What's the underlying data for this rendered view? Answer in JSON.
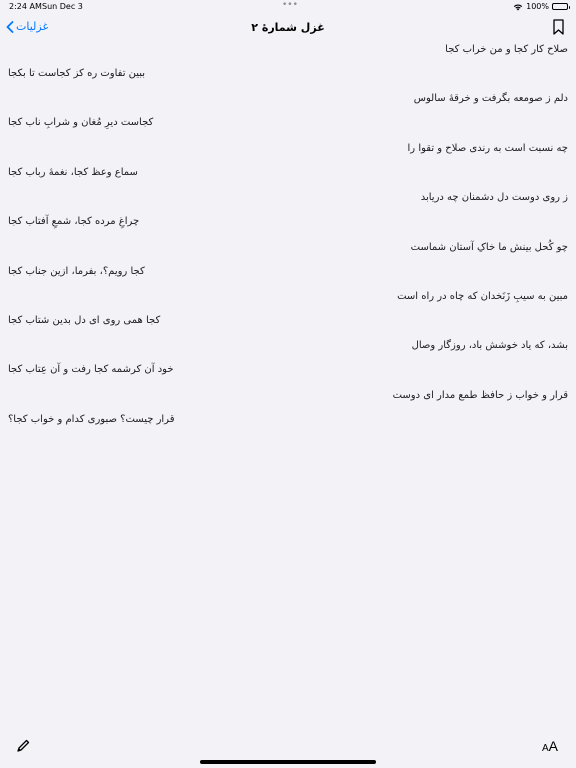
{
  "status_bar": {
    "time": "2:24 AM",
    "date": "Sun Dec 3",
    "battery": "100%",
    "multitask_dots": "•••"
  },
  "nav": {
    "back_label": "غزلیات",
    "title": "غزل شمارهٔ ۲",
    "back_icon": "chevron-left-icon",
    "bookmark_icon": "bookmark-icon",
    "accent_color": "#007aff"
  },
  "poem": {
    "verses": [
      {
        "h1": "صلاح کار کجا و من خراب کجا",
        "h2": "ببین تفاوت ره کز کجاست تا بکجا"
      },
      {
        "h1": "دلم ز صومعه بگرفت و خرقهٔ سالوس",
        "h2": "کجاست دیرِ مُغان و شرابِ ناب کجا"
      },
      {
        "h1": "چه نسبت است به رندی صلاح و تقوا را",
        "h2": "سماع وعظ کجا، نغمهٔ رباب کجا"
      },
      {
        "h1": "ز روی دوست دل دشمنان چه دریابد",
        "h2": "چراغِ مرده کجا، شمعِ آفتاب کجا"
      },
      {
        "h1": "چو کُحل بینش ما خاکِ آستان شماست",
        "h2": "کجا رویم؟، بفرما، ازین جناب کجا"
      },
      {
        "h1": "مبین به سیبِ زَنَخدان که چاه در راه است",
        "h2": "کجا همی روی ای دل بدین شتاب کجا"
      },
      {
        "h1": "بشد، که یاد خوشش باد، روزگار وصال",
        "h2": "خود آن کرشمه کجا رفت و آن عِتاب کجا"
      },
      {
        "h1": "قرار و خواب ز حافظ طمع مدار ای دوست",
        "h2": "قرار چیست؟ صبوری کدام و خواب کجا؟"
      }
    ]
  },
  "toolbar": {
    "edit_icon": "pencil-icon",
    "text_size_small": "A",
    "text_size_big": "A"
  }
}
